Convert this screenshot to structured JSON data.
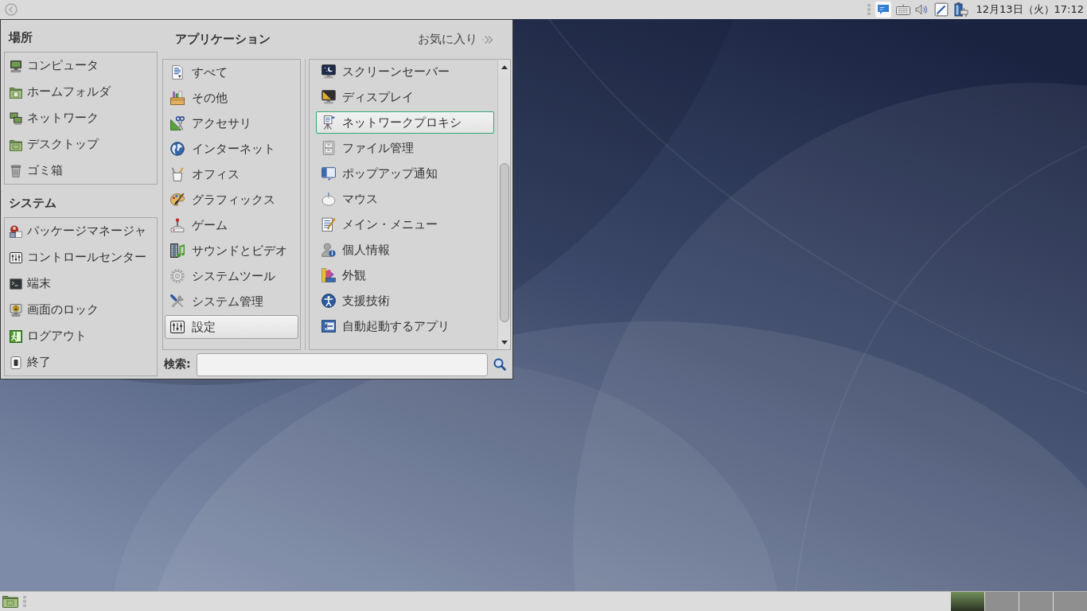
{
  "top_panel": {
    "clock": "12月13日（火）17:12"
  },
  "menu": {
    "places": {
      "title": "場所",
      "items": [
        "コンピュータ",
        "ホームフォルダ",
        "ネットワーク",
        "デスクトップ",
        "ゴミ箱"
      ]
    },
    "system": {
      "title": "システム",
      "items": [
        "パッケージマネージャ",
        "コントロールセンター",
        "端末",
        "画面のロック",
        "ログアウト",
        "終了"
      ]
    },
    "applications": {
      "title": "アプリケーション",
      "categories": [
        {
          "label": "すべて",
          "selected": false
        },
        {
          "label": "その他",
          "selected": false
        },
        {
          "label": "アクセサリ",
          "selected": false
        },
        {
          "label": "インターネット",
          "selected": false
        },
        {
          "label": "オフィス",
          "selected": false
        },
        {
          "label": "グラフィックス",
          "selected": false
        },
        {
          "label": "ゲーム",
          "selected": false
        },
        {
          "label": "サウンドとビデオ",
          "selected": false
        },
        {
          "label": "システムツール",
          "selected": false
        },
        {
          "label": "システム管理",
          "selected": false
        },
        {
          "label": "設定",
          "selected": true
        }
      ]
    },
    "favorites": "お気に入り",
    "settings_items": [
      {
        "label": "スクリーンセーバー",
        "focused": false
      },
      {
        "label": "ディスプレイ",
        "focused": false
      },
      {
        "label": "ネットワークプロキシ",
        "focused": true
      },
      {
        "label": "ファイル管理",
        "focused": false
      },
      {
        "label": "ポップアップ通知",
        "focused": false
      },
      {
        "label": "マウス",
        "focused": false
      },
      {
        "label": "メイン・メニュー",
        "focused": false
      },
      {
        "label": "個人情報",
        "focused": false
      },
      {
        "label": "外観",
        "focused": false
      },
      {
        "label": "支援技術",
        "focused": false
      },
      {
        "label": "自動起動するアプリ",
        "focused": false
      }
    ],
    "search": {
      "label": "検索:"
    }
  },
  "bottom_panel": {
    "workspaces": [
      {
        "selected": true
      },
      {
        "selected": false
      },
      {
        "selected": false
      },
      {
        "selected": false
      }
    ]
  }
}
